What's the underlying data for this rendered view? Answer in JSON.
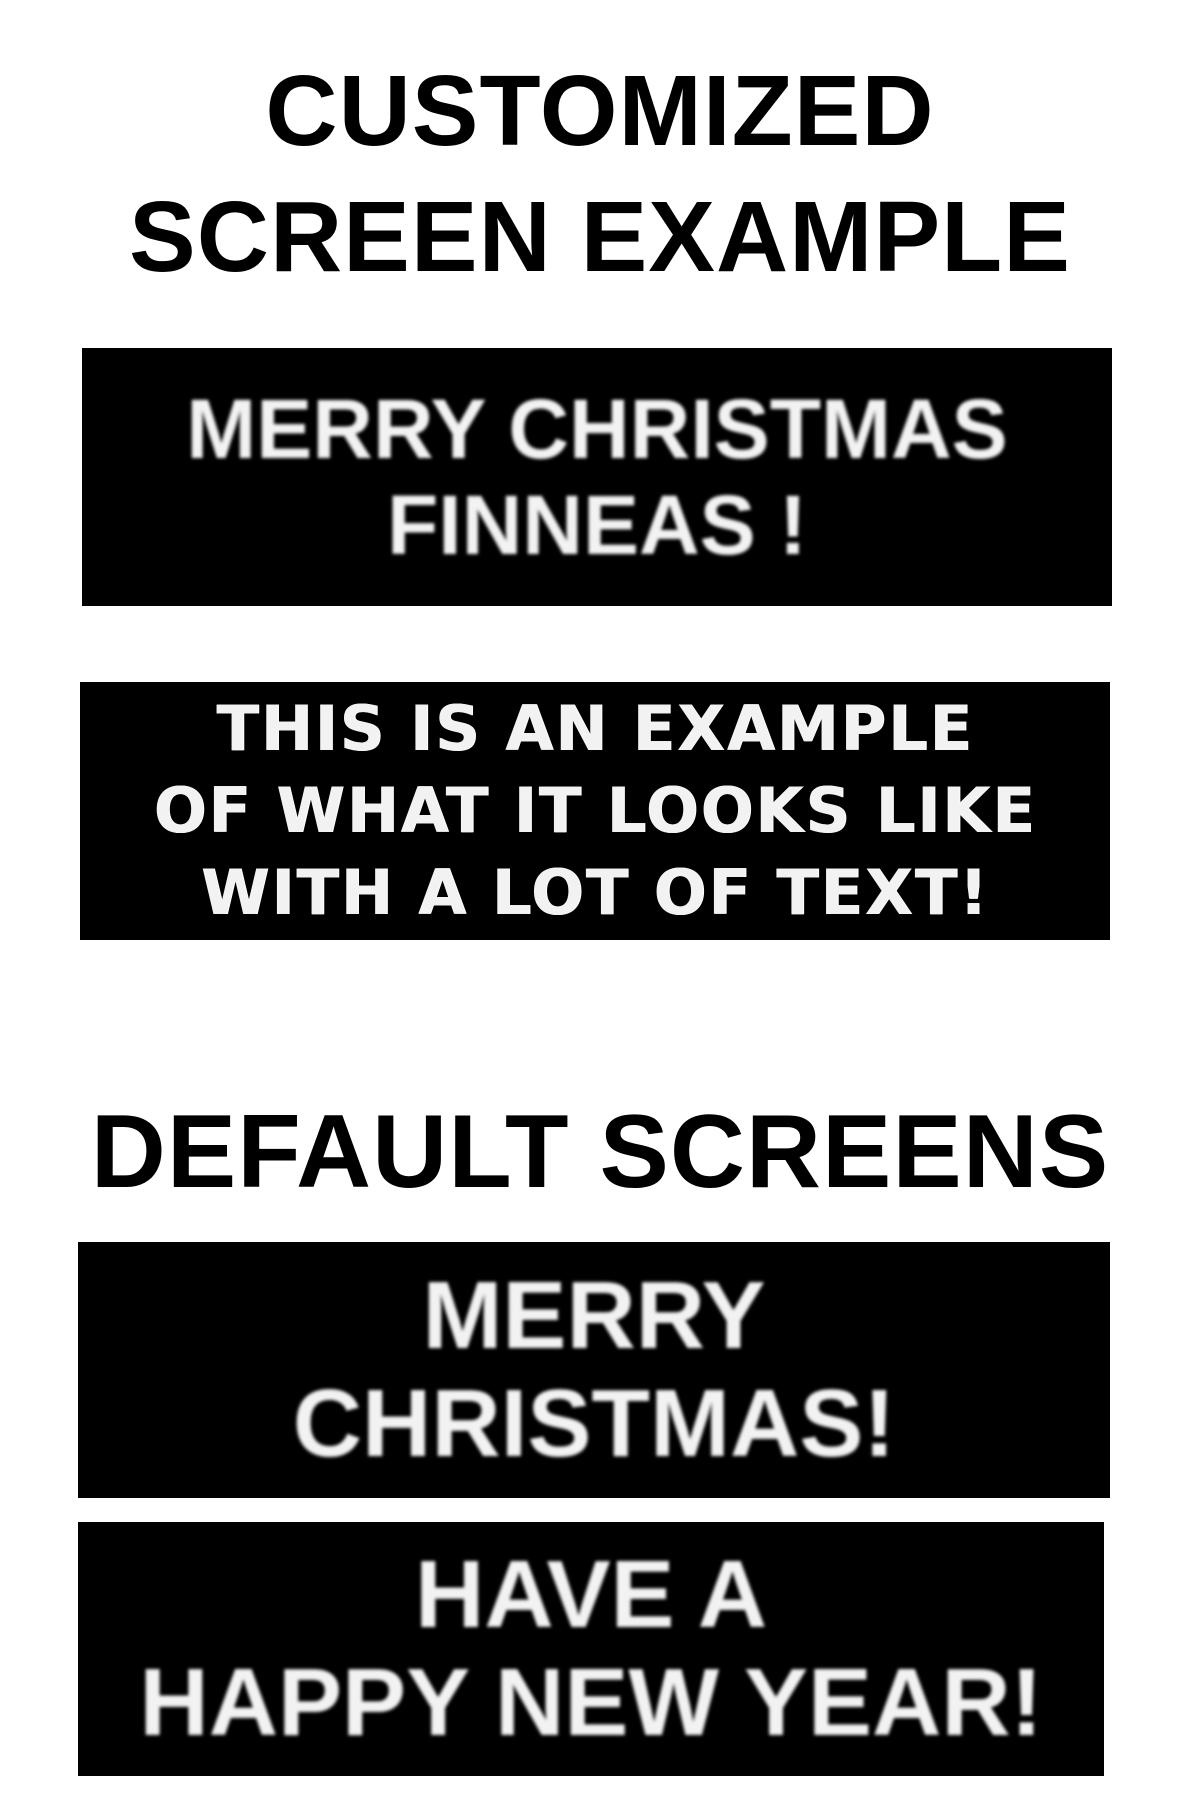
{
  "customized_heading": {
    "line1": "CUSTOMIZED",
    "line2": "SCREEN EXAMPLE"
  },
  "customized_screens": [
    {
      "lines": [
        "MERRY CHRISTMAS",
        "FINNEAS !"
      ]
    },
    {
      "lines": [
        "THIS IS AN EXAMPLE",
        "OF WHAT IT LOOKS LIKE",
        "WITH A LOT OF TEXT!"
      ]
    }
  ],
  "default_heading": {
    "line1": "DEFAULT SCREENS"
  },
  "default_screens": [
    {
      "lines": [
        "MERRY",
        "CHRISTMAS!"
      ]
    },
    {
      "lines": [
        "HAVE A",
        "HAPPY NEW YEAR!"
      ]
    }
  ],
  "colors": {
    "page_background": "#ffffff",
    "heading_text": "#000000",
    "screen_background": "#000000",
    "screen_text": "#f2f2f2"
  }
}
